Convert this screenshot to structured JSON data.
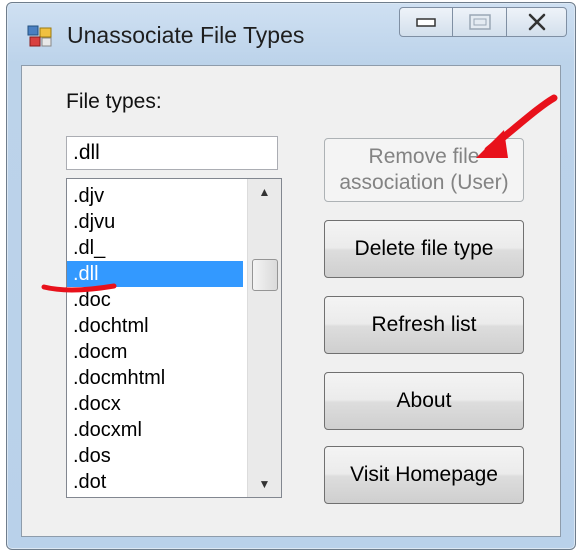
{
  "window": {
    "title": "Unassociate File Types",
    "caption_buttons": [
      "minimize",
      "maximize",
      "close"
    ]
  },
  "file_types": {
    "label": "File types:",
    "input_value": ".dll",
    "items": [
      ".djv",
      ".djvu",
      ".dl_",
      ".dll",
      ".doc",
      ".dochtml",
      ".docm",
      ".docmhtml",
      ".docx",
      ".docxml",
      ".dos",
      ".dot"
    ],
    "selected": ".dll"
  },
  "buttons": {
    "remove_association": "Remove file association (User)",
    "delete_file_type": "Delete file type",
    "refresh_list": "Refresh list",
    "about": "About",
    "visit_homepage": "Visit Homepage"
  },
  "colors": {
    "selection": "#3399ff",
    "annotation": "#e8111b"
  },
  "icons": {
    "app": "app-icon",
    "scroll_up": "scroll-up-icon",
    "scroll_down": "scroll-down-icon"
  }
}
